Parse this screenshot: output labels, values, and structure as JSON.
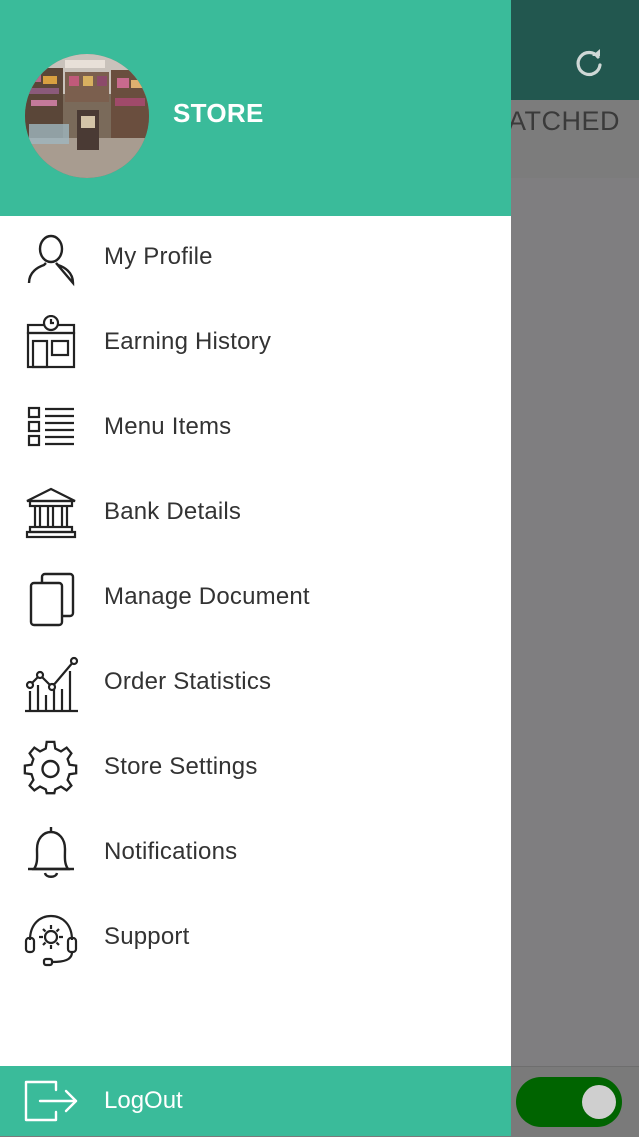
{
  "background": {
    "tab_partial_label": "ATCHED",
    "refresh_icon": "refresh-icon",
    "toggle_on": true
  },
  "drawer": {
    "store_name": "STORE",
    "avatar": "store-photo",
    "menu": [
      {
        "label": "My Profile",
        "icon": "user-icon"
      },
      {
        "label": "Earning History",
        "icon": "store-clock-icon"
      },
      {
        "label": "Menu Items",
        "icon": "list-icon"
      },
      {
        "label": "Bank Details",
        "icon": "bank-icon"
      },
      {
        "label": "Manage Document",
        "icon": "documents-icon"
      },
      {
        "label": "Order Statistics",
        "icon": "chart-icon"
      },
      {
        "label": "Store Settings",
        "icon": "gear-icon"
      },
      {
        "label": "Notifications",
        "icon": "bell-icon"
      },
      {
        "label": "Support",
        "icon": "headset-icon"
      }
    ],
    "logout_label": "LogOut"
  },
  "colors": {
    "accent": "#3abb9a",
    "app_bar": "#22574f",
    "scrim": "#7f7e80",
    "toggle": "#006400"
  }
}
